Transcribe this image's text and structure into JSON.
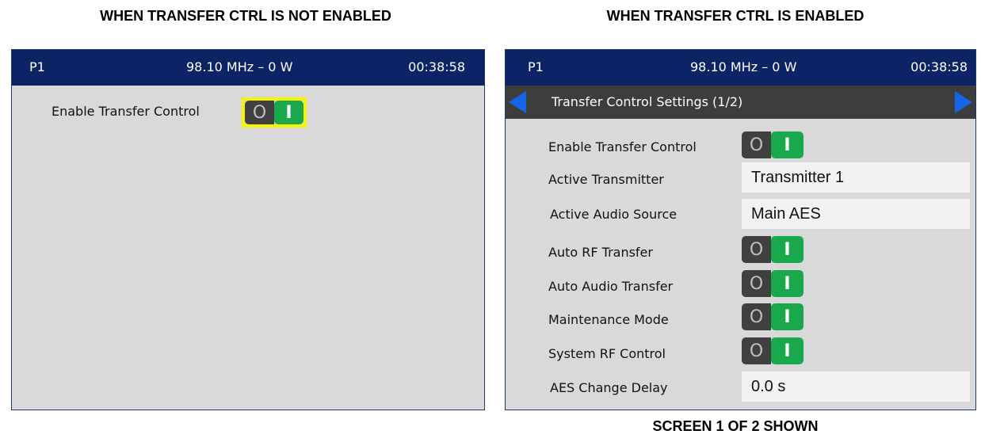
{
  "captions": {
    "left": "WHEN TRANSFER CTRL IS NOT ENABLED",
    "right": "WHEN TRANSFER CTRL IS ENABLED",
    "bottom": "SCREEN 1 OF 2 SHOWN"
  },
  "left_screen": {
    "status": {
      "preset": "P1",
      "frequency_power": "98.10 MHz – 0 W",
      "time": "00:38:58"
    },
    "enable_label": "Enable Transfer Control",
    "toggle": {
      "off": "O",
      "on": "I"
    }
  },
  "right_screen": {
    "status": {
      "preset": "P1",
      "frequency_power": "98.10 MHz – 0 W",
      "time": "00:38:58"
    },
    "header_title": "Transfer Control Settings (1/2)",
    "toggle": {
      "off": "O",
      "on": "I"
    },
    "rows": {
      "enable_transfer_control": "Enable Transfer Control",
      "active_transmitter": {
        "label": "Active Transmitter",
        "value": "Transmitter 1"
      },
      "active_audio_source": {
        "label": "Active Audio Source",
        "value": "Main AES"
      },
      "auto_rf_transfer": "Auto RF Transfer",
      "auto_audio_transfer": "Auto Audio Transfer",
      "maintenance_mode": "Maintenance Mode",
      "system_rf_control": "System RF Control",
      "aes_change_delay": {
        "label": "AES Change Delay",
        "value": "0.0 s"
      }
    }
  },
  "colors": {
    "status_bar": "#0c2466",
    "subheader": "#3d3d3d",
    "toggle_on": "#19a84b",
    "toggle_off": "#404040",
    "highlight": "#f5f500",
    "arrow": "#1565e6",
    "screen_bg": "#d9d9d9"
  }
}
